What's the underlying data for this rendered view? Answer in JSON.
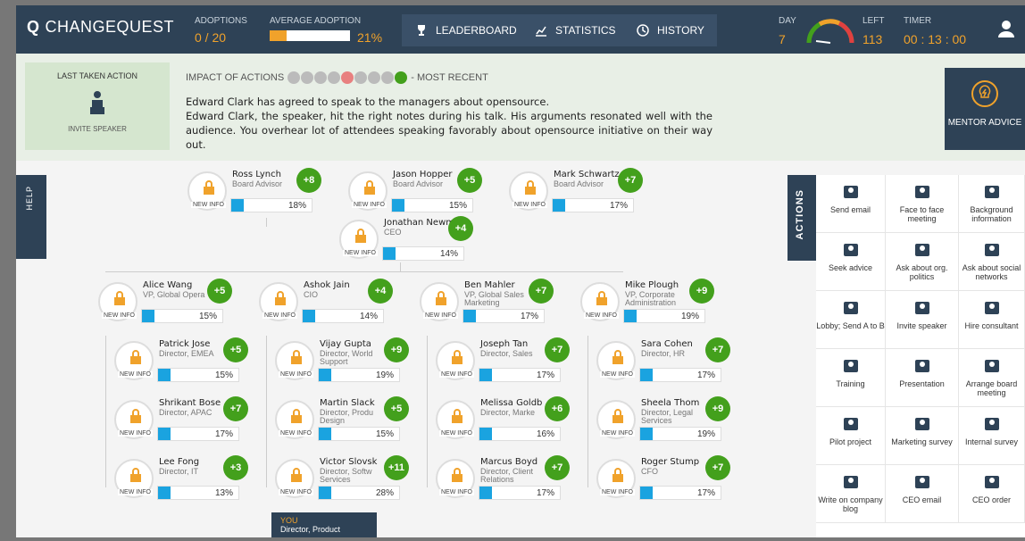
{
  "app": {
    "logo_q": "Q",
    "logo_text": "CHANGEQUEST"
  },
  "topbar": {
    "adoptions_label": "ADOPTIONS",
    "adoptions_value": "0 / 20",
    "avg_label": "AVERAGE ADOPTION",
    "avg_value": "21%",
    "avg_fraction": 0.21,
    "buttons": [
      "LEADERBOARD",
      "STATISTICS",
      "HISTORY"
    ],
    "day_label": "DAY",
    "day_value": "7",
    "left_label": "LEFT",
    "left_value": "113",
    "timer_label": "TIMER",
    "timer_value": "00 : 13 : 00",
    "accent": "#f0a22b",
    "bg": "#2e4256"
  },
  "last_action": {
    "title": "LAST TAKEN ACTION",
    "action": "INVITE SPEAKER"
  },
  "impact": {
    "label": "IMPACT OF ACTIONS",
    "dots": [
      "#bbbbbb",
      "#bbbbbb",
      "#bbbbbb",
      "#bbbbbb",
      "#e88080",
      "#bbbbbb",
      "#bbbbbb",
      "#bbbbbb",
      "#43a01c"
    ],
    "recent": "- MOST RECENT",
    "message_line1": "Edward Clark has agreed to speak to the managers about opensource.",
    "message_line2": "Edward Clark, the speaker, hit the right notes during his talk. His arguments resonated well with the audience. You overhear lot of attendees speaking favorably about opensource initiative on their way out."
  },
  "mentor": {
    "label": "MENTOR ADVICE"
  },
  "help": {
    "label": "HELP"
  },
  "new_info": "NEW INFO",
  "people": [
    {
      "name": "Ross Lynch",
      "role": "Board Advisor",
      "pct": "18%",
      "score": "+8"
    },
    {
      "name": "Jason Hopper",
      "role": "Board Advisor",
      "pct": "15%",
      "score": "+5"
    },
    {
      "name": "Mark Schwartz",
      "role": "Board Advisor",
      "pct": "17%",
      "score": "+7"
    },
    {
      "name": "Jonathan Newm",
      "role": "CEO",
      "pct": "14%",
      "score": "+4"
    },
    {
      "name": "Alice Wang",
      "role": "VP, Global Opera",
      "pct": "15%",
      "score": "+5"
    },
    {
      "name": "Ashok Jain",
      "role": "CIO",
      "pct": "14%",
      "score": "+4"
    },
    {
      "name": "Ben Mahler",
      "role": "VP, Global Sales Marketing",
      "pct": "17%",
      "score": "+7"
    },
    {
      "name": "Mike Plough",
      "role": "VP, Corporate Administration",
      "pct": "19%",
      "score": "+9"
    },
    {
      "name": "Patrick Jose",
      "role": "Director, EMEA",
      "pct": "15%",
      "score": "+5"
    },
    {
      "name": "Vijay Gupta",
      "role": "Director, World Support",
      "pct": "19%",
      "score": "+9"
    },
    {
      "name": "Joseph Tan",
      "role": "Director, Sales",
      "pct": "17%",
      "score": "+7"
    },
    {
      "name": "Sara Cohen",
      "role": "Director, HR",
      "pct": "17%",
      "score": "+7"
    },
    {
      "name": "Shrikant Bose",
      "role": "Director, APAC",
      "pct": "17%",
      "score": "+7"
    },
    {
      "name": "Martin Slack",
      "role": "Director, Produ Design",
      "pct": "15%",
      "score": "+5"
    },
    {
      "name": "Melissa Goldb",
      "role": "Director, Marke",
      "pct": "16%",
      "score": "+6"
    },
    {
      "name": "Sheela Thom",
      "role": "Director, Legal Services",
      "pct": "19%",
      "score": "+9"
    },
    {
      "name": "Lee Fong",
      "role": "Director, IT",
      "pct": "13%",
      "score": "+3"
    },
    {
      "name": "Victor Slovsk",
      "role": "Director, Softw Services",
      "pct": "28%",
      "score": "+11"
    },
    {
      "name": "Marcus Boyd",
      "role": "Director, Client Relations",
      "pct": "17%",
      "score": "+7"
    },
    {
      "name": "Roger Stump",
      "role": "CFO",
      "pct": "17%",
      "score": "+7"
    }
  ],
  "you": {
    "label": "YOU",
    "role": "Director, Product"
  },
  "actions_tab": "ACTIONS",
  "actions": [
    {
      "label": "Send email",
      "icon": "email-icon"
    },
    {
      "label": "Face to face meeting",
      "icon": "meeting-icon"
    },
    {
      "label": "Background information",
      "icon": "magnifier-icon"
    },
    {
      "label": "Seek advice",
      "icon": "advice-icon"
    },
    {
      "label": "Ask about org. politics",
      "icon": "politics-icon"
    },
    {
      "label": "Ask about social networks",
      "icon": "network-icon"
    },
    {
      "label": "Lobby; Send A to B",
      "icon": "lobby-icon"
    },
    {
      "label": "Invite speaker",
      "icon": "speaker-icon"
    },
    {
      "label": "Hire consultant",
      "icon": "consultant-icon"
    },
    {
      "label": "Training",
      "icon": "training-icon"
    },
    {
      "label": "Presentation",
      "icon": "presentation-icon"
    },
    {
      "label": "Arrange board meeting",
      "icon": "board-icon"
    },
    {
      "label": "Pilot project",
      "icon": "pilot-icon"
    },
    {
      "label": "Marketing survey",
      "icon": "survey-icon"
    },
    {
      "label": "Internal survey",
      "icon": "internal-survey-icon"
    },
    {
      "label": "Write on company blog",
      "icon": "blog-icon"
    },
    {
      "label": "CEO email",
      "icon": "ceo-email-icon"
    },
    {
      "label": "CEO order",
      "icon": "ceo-order-icon"
    }
  ]
}
